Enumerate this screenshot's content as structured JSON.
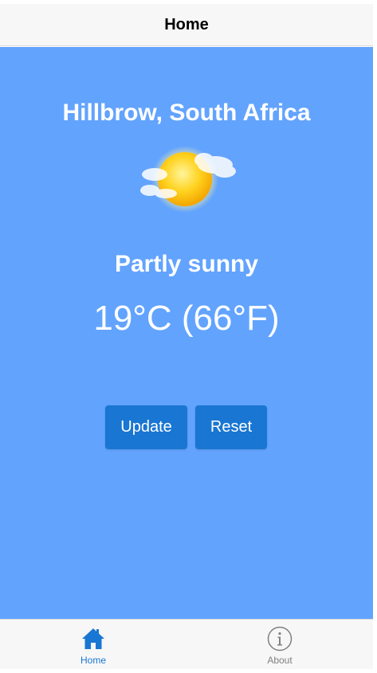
{
  "header": {
    "title": "Home"
  },
  "weather": {
    "location": "Hillbrow, South Africa",
    "icon": "partly-sunny-icon",
    "condition": "Partly sunny",
    "temperature": "19°C (66°F)"
  },
  "actions": {
    "update_label": "Update",
    "reset_label": "Reset"
  },
  "tabs": [
    {
      "label": "Home",
      "icon": "home-icon",
      "active": true
    },
    {
      "label": "About",
      "icon": "info-icon",
      "active": false
    }
  ],
  "colors": {
    "background": "#62a3fe",
    "accent": "#1976d2",
    "bar": "#f7f7f7",
    "inactive": "#808080"
  }
}
